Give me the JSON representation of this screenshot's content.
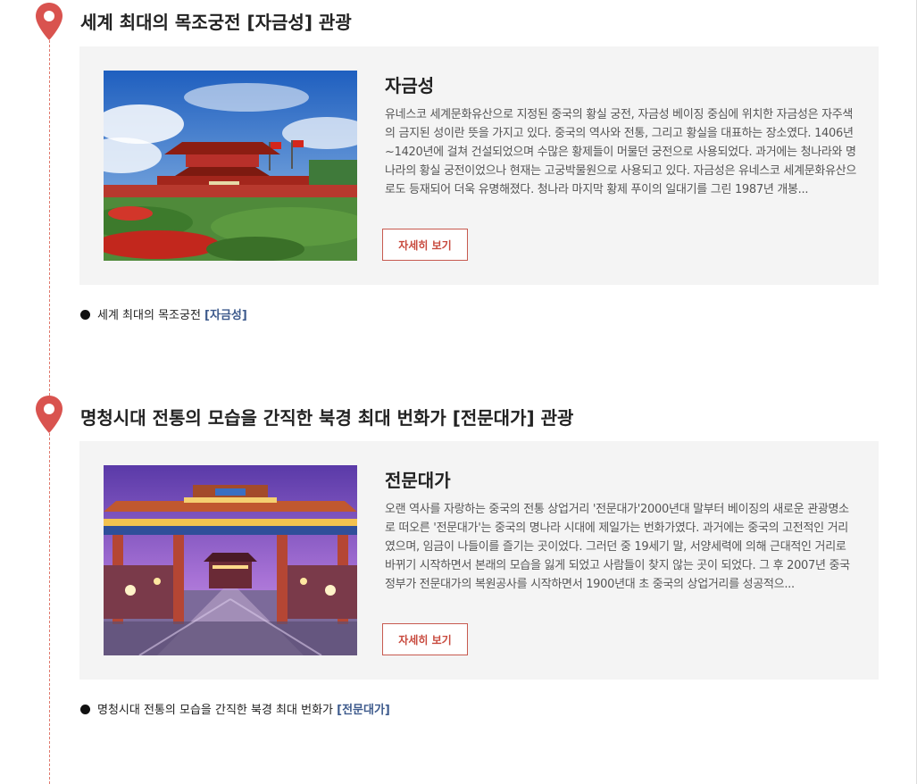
{
  "colors": {
    "accent": "#d9534f",
    "link": "#3d5a8c",
    "card_bg": "#f4f4f4"
  },
  "sections": [
    {
      "title": "세계 최대의 목조궁전 [자금성] 관광",
      "card": {
        "name": "자금성",
        "description": "유네스코 세계문화유산으로 지정된 중국의 황실 궁전, 자금성 베이징 중심에 위치한 자금성은 자주색의 금지된 성이란 뜻을 가지고 있다. 중국의 역사와 전통, 그리고 황실을 대표하는 장소였다. 1406년~1420년에 걸쳐 건설되었으며 수많은 황제들이 머물던 궁전으로 사용되었다. 과거에는 청나라와 명나라의 황실 궁전이었으나 현재는 고궁박물원으로 사용되고 있다. 자금성은 유네스코 세계문화유산으로도 등재되어 더욱 유명해졌다. 청나라 마지막 황제 푸이의 일대기를 그린 1987년 개봉...",
        "button": "자세히 보기"
      },
      "caption": {
        "text": "세계 최대의 목조궁전",
        "link": "[자금성]"
      }
    },
    {
      "title": "명청시대 전통의 모습을 간직한 북경 최대 번화가 [전문대가] 관광",
      "card": {
        "name": "전문대가",
        "description": "오랜 역사를 자랑하는 중국의 전통 상업거리 '전문대가'2000년대 말부터 베이징의 새로운 관광명소로 떠오른 '전문대가'는 중국의 명나라 시대에 제일가는 번화가였다. 과거에는 중국의 고전적인 거리였으며, 임금이 나들이를 즐기는 곳이었다. 그러던 중 19세기 말, 서양세력에 의해 근대적인 거리로 바뀌기 시작하면서 본래의 모습을 잃게 되었고 사람들이 찾지 않는 곳이 되었다. 그 후 2007년 중국정부가 전문대가의 복원공사를 시작하면서 1900년대 초 중국의 상업거리를 성공적으...",
        "button": "자세히 보기"
      },
      "caption": {
        "text": "명청시대 전통의 모습을 간직한 북경 최대 번화가",
        "link": "[전문대가]"
      }
    }
  ]
}
